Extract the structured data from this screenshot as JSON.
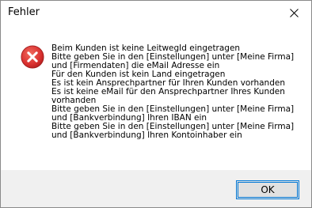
{
  "window": {
    "title": "Fehler"
  },
  "icons": {
    "close": "close-icon",
    "error": "error-icon"
  },
  "colors": {
    "error_red": "#d9302f",
    "button_focus": "#0078d7",
    "footer_bg": "#f0f0f0"
  },
  "message": {
    "lines": [
      "Beim Kunden ist keine LeitwegId eingetragen",
      "Bitte geben Sie in den [Einstellungen] unter [Meine Firma]",
      "und [Firmendaten]  die eMail Adresse ein",
      "Für den Kunden ist kein Land eingetragen",
      "Es ist kein Ansprechpartner für Ihren Kunden vorhanden",
      "Es ist keine eMail für den Ansprechpartner Ihres Kunden",
      "vorhanden",
      "Bitte geben Sie in den [Einstellungen] unter [Meine Firma]",
      "und [Bankverbindung] Ihren IBAN ein",
      "Bitte geben Sie in den [Einstellungen] unter [Meine Firma]",
      "und [Bankverbindung] Ihren Kontoinhaber ein"
    ]
  },
  "buttons": {
    "ok_label": "OK"
  }
}
